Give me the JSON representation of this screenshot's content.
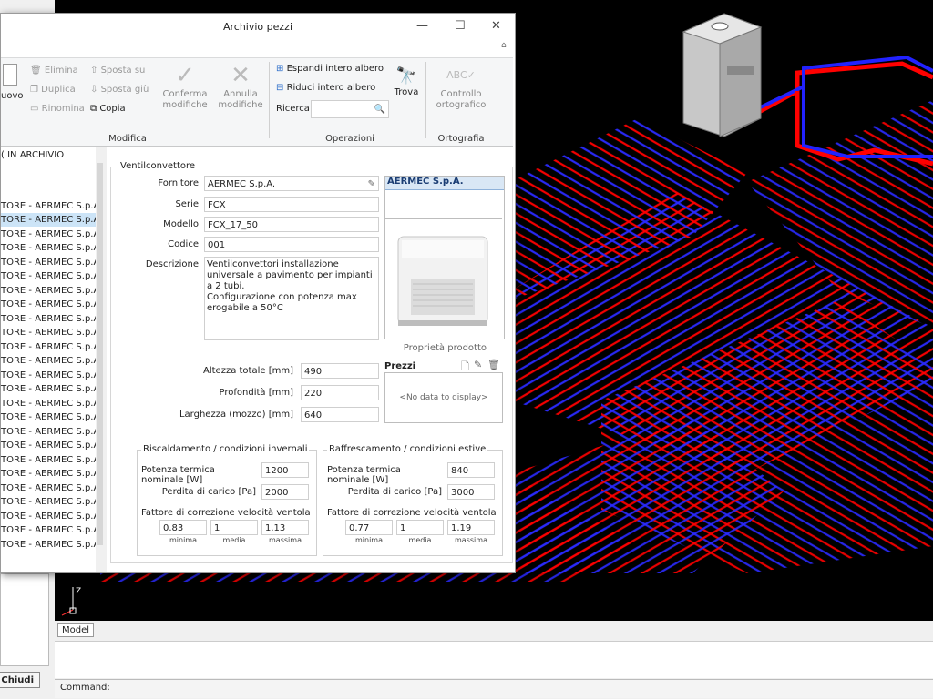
{
  "window": {
    "title": "Archivio pezzi"
  },
  "ribbon": {
    "new_label": "uovo",
    "elimina": "Elimina",
    "duplica": "Duplica",
    "rinomina": "Rinomina",
    "sposta_su": "Sposta su",
    "sposta_giu": "Sposta giù",
    "copia": "Copia",
    "conferma": [
      "Conferma",
      "modifiche"
    ],
    "annulla": [
      "Annulla",
      "modifiche"
    ],
    "modifica_group": "Modifica",
    "espandi": "Espandi intero albero",
    "riduci": "Riduci intero albero",
    "ricerca": "Ricerca",
    "trova": "Trova",
    "operazioni_group": "Operazioni",
    "controllo": [
      "Controllo",
      "ortografico"
    ],
    "abc": "ABC",
    "ortografia_group": "Ortografia"
  },
  "tree": {
    "root": "( IN ARCHIVIO",
    "item": "TORE - AERMEC S.p.A."
  },
  "form": {
    "group_title": "Ventilconvettore",
    "fornitore_label": "Fornitore",
    "fornitore": "AERMEC S.p.A.",
    "serie_label": "Serie",
    "serie": "FCX",
    "modello_label": "Modello",
    "modello": "FCX_17_50",
    "codice_label": "Codice",
    "codice": "001",
    "descrizione_label": "Descrizione",
    "descrizione": "Ventilconvettori installazione universale a pavimento per impianti a 2 tubi.\nConfigurazione con potenza max erogabile a 50°C",
    "brand_header": "AERMEC S.p.A.",
    "proprieta": "Proprietà prodotto",
    "altezza_label": "Altezza totale [mm]",
    "altezza": "490",
    "profondita_label": "Profondità [mm]",
    "profondita": "220",
    "larghezza_label": "Larghezza (mozzo) [mm]",
    "larghezza": "640",
    "prezzi_title": "Prezzi",
    "no_data": "<No data to display>"
  },
  "heating": {
    "title": "Riscaldamento / condizioni invernali",
    "potenza_label": "Potenza termica nominale [W]",
    "potenza": "1200",
    "perdita_label": "Perdita di carico [Pa]",
    "perdita": "2000",
    "fattore_label": "Fattore di correzione velocità ventola",
    "min": "0.83",
    "med": "1",
    "max": "1.13",
    "min_label": "minima",
    "med_label": "media",
    "max_label": "massima"
  },
  "cooling": {
    "title": "Raffrescamento / condizioni estive",
    "potenza_label": "Potenza termica nominale [W]",
    "potenza": "840",
    "perdita_label": "Perdita di carico [Pa]",
    "perdita": "3000",
    "fattore_label": "Fattore di correzione velocità ventola",
    "min": "0.77",
    "med": "1",
    "max": "1.19",
    "min_label": "minima",
    "med_label": "media",
    "max_label": "massima"
  },
  "cad": {
    "model_tab": "Model",
    "command_label": "Command:",
    "axis_z": "Z"
  },
  "footer": {
    "chiudi": "Chiudi"
  },
  "colors": {
    "pipe_red": "#ff0000",
    "pipe_blue": "#2222ff",
    "background": "#000000"
  }
}
